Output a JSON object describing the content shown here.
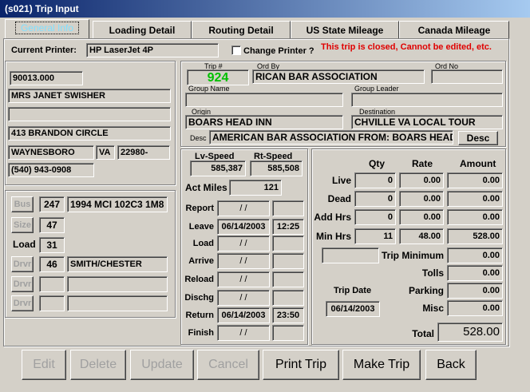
{
  "window": {
    "title": "(s021)  Trip Input"
  },
  "tabs": [
    {
      "label": "General Info"
    },
    {
      "label": "Loading Detail"
    },
    {
      "label": "Routing Detail"
    },
    {
      "label": "US State Mileage"
    },
    {
      "label": "Canada Mileage"
    }
  ],
  "printer": {
    "label": "Current Printer:",
    "value": "HP LaserJet 4P",
    "change_label": "Change Printer ?",
    "change_checked": false
  },
  "status_message": "This trip is closed, Cannot be edited, etc.",
  "customer": {
    "id": "90013.000",
    "name": "MRS JANET SWISHER",
    "line2": "",
    "address": "413 BRANDON CIRCLE",
    "city": "WAYNESBORO",
    "state": "VA",
    "zip": "22980-",
    "phone": "(540) 943-0908"
  },
  "trip": {
    "trip_no_label": "Trip #",
    "trip_no": "924",
    "ord_by_label": "Ord By",
    "ord_by": "RICAN BAR ASSOCIATION",
    "ord_no_label": "Ord No",
    "ord_no": "",
    "group_name_label": "Group Name",
    "group_name": "",
    "group_leader_label": "Group Leader",
    "group_leader": "",
    "origin_label": "Origin",
    "origin": "BOARS HEAD INN",
    "destination_label": "Destination",
    "destination": "CHVILLE VA LOCAL TOUR",
    "desc_label": "Desc",
    "desc": "AMERICAN BAR ASSOCIATION FROM: BOARS HEAD IN",
    "desc_button": "Desc"
  },
  "vehicle": {
    "bus_label": "Bus",
    "bus_no": "247",
    "bus_desc": "1994 MCI 102C3 1M8",
    "size_label": "Size",
    "size": "47",
    "load_label": "Load",
    "load": "31",
    "drivers": [
      {
        "label": "Drvr",
        "no": "46",
        "name": "SMITH/CHESTER"
      },
      {
        "label": "Drvr",
        "no": "",
        "name": ""
      },
      {
        "label": "Drvr",
        "no": "",
        "name": ""
      }
    ]
  },
  "speed": {
    "lv_label": "Lv-Speed",
    "lv": "585,387",
    "rt_label": "Rt-Speed",
    "rt": "585,508",
    "act_miles_label": "Act Miles",
    "act_miles": "121"
  },
  "schedule": [
    {
      "label": "Report",
      "date": " / /",
      "time": ""
    },
    {
      "label": "Leave",
      "date": "06/14/2003",
      "time": "12:25"
    },
    {
      "label": "Load",
      "date": " / /",
      "time": ""
    },
    {
      "label": "Arrive",
      "date": " / /",
      "time": ""
    },
    {
      "label": "Reload",
      "date": " / /",
      "time": ""
    },
    {
      "label": "Dischg",
      "date": " / /",
      "time": ""
    },
    {
      "label": "Return",
      "date": "06/14/2003",
      "time": "23:50"
    },
    {
      "label": "Finish",
      "date": " / /",
      "time": ""
    }
  ],
  "charges": {
    "headers": {
      "qty": "Qty",
      "rate": "Rate",
      "amount": "Amount"
    },
    "rows": [
      {
        "label": "Live",
        "qty": "0",
        "rate": "0.00",
        "amount": "0.00"
      },
      {
        "label": "Dead",
        "qty": "0",
        "rate": "0.00",
        "amount": "0.00"
      },
      {
        "label": "Add Hrs",
        "qty": "0",
        "rate": "0.00",
        "amount": "0.00"
      },
      {
        "label": "Min Hrs",
        "qty": "11",
        "rate": "48.00",
        "amount": "528.00"
      }
    ],
    "trip_minimum_label": "Trip Minimum",
    "trip_minimum": "0.00",
    "tolls_label": "Tolls",
    "tolls": "0.00",
    "parking_label": "Parking",
    "parking": "0.00",
    "misc_label": "Misc",
    "misc": "0.00",
    "trip_date_label": "Trip Date",
    "trip_date": "06/14/2003",
    "total_label": "Total",
    "total": "528.00"
  },
  "buttons": {
    "edit": "Edit",
    "delete": "Delete",
    "update": "Update",
    "cancel": "Cancel",
    "print_trip": "Print Trip",
    "make_trip": "Make Trip",
    "back": "Back"
  }
}
